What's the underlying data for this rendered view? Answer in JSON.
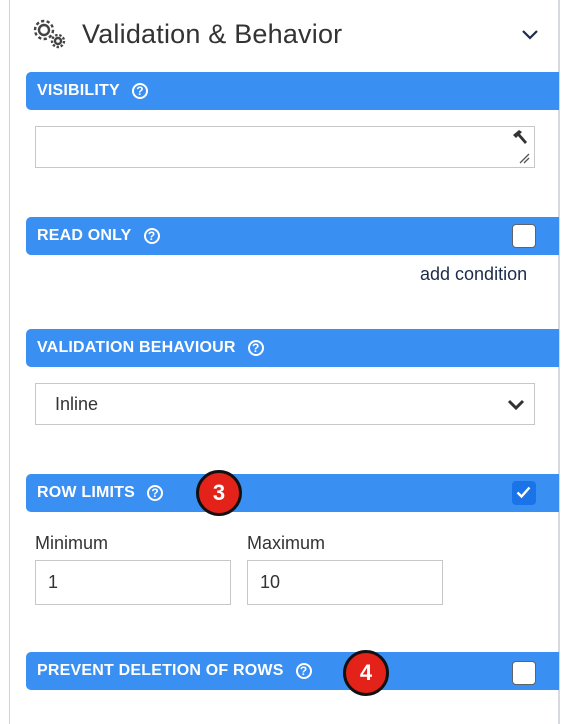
{
  "header": {
    "title": "Validation & Behavior",
    "icon": "gears-icon",
    "toggle_icon": "chevron-down-icon"
  },
  "visibility": {
    "label": "VISIBILITY",
    "help": "?",
    "value": ""
  },
  "read_only": {
    "label": "READ ONLY",
    "help": "?",
    "checked": false,
    "add_condition": "add condition"
  },
  "validation_behaviour": {
    "label": "VALIDATION BEHAVIOUR",
    "help": "?",
    "selected": "Inline"
  },
  "row_limits": {
    "label": "ROW LIMITS",
    "help": "?",
    "checked": true,
    "badge": "3",
    "minimum_label": "Minimum",
    "minimum_value": "1",
    "maximum_label": "Maximum",
    "maximum_value": "10"
  },
  "prevent_deletion": {
    "label": "PREVENT DELETION OF ROWS",
    "help": "?",
    "checked": false,
    "badge": "4"
  },
  "colors": {
    "accent": "#3a8ff2",
    "checkbox_on": "#1a73e8",
    "badge": "#e3221a"
  }
}
